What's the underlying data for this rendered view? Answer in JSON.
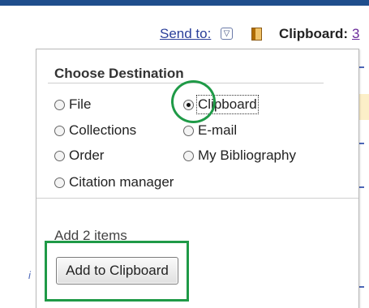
{
  "header": {
    "send_to_label": "Send to:",
    "send_to_arrow": "▽",
    "clipboard_label": "Clipboard:",
    "clipboard_count": "3"
  },
  "dropdown": {
    "title": "Choose Destination",
    "options": [
      {
        "label": "File",
        "selected": false
      },
      {
        "label": "Clipboard",
        "selected": true
      },
      {
        "label": "Collections",
        "selected": false
      },
      {
        "label": "E-mail",
        "selected": false
      },
      {
        "label": "Order",
        "selected": false
      },
      {
        "label": "My Bibliography",
        "selected": false
      },
      {
        "label": "Citation manager",
        "selected": false
      }
    ],
    "add_items_text": "Add 2 items",
    "add_button_label": "Add to Clipboard"
  },
  "colors": {
    "link": "#2a3f9a",
    "annotation": "#1f9a47",
    "top_bar": "#1f4e8c"
  },
  "icons": {
    "send_to_dropdown": "triangle-down-icon",
    "clipboard": "clipboard-icon"
  }
}
